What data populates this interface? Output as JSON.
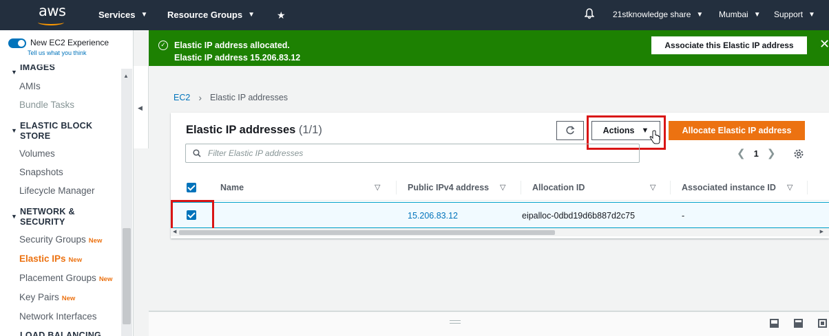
{
  "topnav": {
    "logo": "aws",
    "services": "Services",
    "resource_groups": "Resource Groups",
    "account": "21stknowledge share",
    "region": "Mumbai",
    "support": "Support"
  },
  "sidebar": {
    "new_experience": "New EC2 Experience",
    "tell_us": "Tell us what you think",
    "sections": {
      "images": "IMAGES",
      "ebs_line1": "ELASTIC BLOCK",
      "ebs_line2": "STORE",
      "network_line1": "NETWORK &",
      "network_line2": "SECURITY",
      "load_balancing": "LOAD BALANCING"
    },
    "items": {
      "amis": "AMIs",
      "bundle_tasks": "Bundle Tasks",
      "volumes": "Volumes",
      "snapshots": "Snapshots",
      "lifecycle_manager": "Lifecycle Manager",
      "security_groups": "Security Groups",
      "elastic_ips": "Elastic IPs",
      "placement_groups": "Placement Groups",
      "key_pairs": "Key Pairs",
      "network_interfaces": "Network Interfaces"
    },
    "new_badge": "New"
  },
  "flash": {
    "title": "Elastic IP address allocated.",
    "message": "Elastic IP address 15.206.83.12",
    "button": "Associate this Elastic IP address"
  },
  "breadcrumb": {
    "root": "EC2",
    "current": "Elastic IP addresses"
  },
  "panel": {
    "title": "Elastic IP addresses",
    "count": "(1/1)",
    "actions": "Actions",
    "allocate": "Allocate Elastic IP address",
    "filter_placeholder": "Filter Elastic IP addresses",
    "page": "1"
  },
  "table": {
    "columns": [
      "Name",
      "Public IPv4 address",
      "Allocation ID",
      "Associated instance ID"
    ],
    "rows": [
      {
        "name": "",
        "public_ip": "15.206.83.12",
        "allocation_id": "eipalloc-0dbd19d6b887d2c75",
        "instance_id": "-"
      }
    ]
  },
  "colors": {
    "nav_bg": "#232f3e",
    "success": "#1d8102",
    "primary": "#ec7211",
    "link": "#0073bb",
    "highlight": "#d91515"
  }
}
